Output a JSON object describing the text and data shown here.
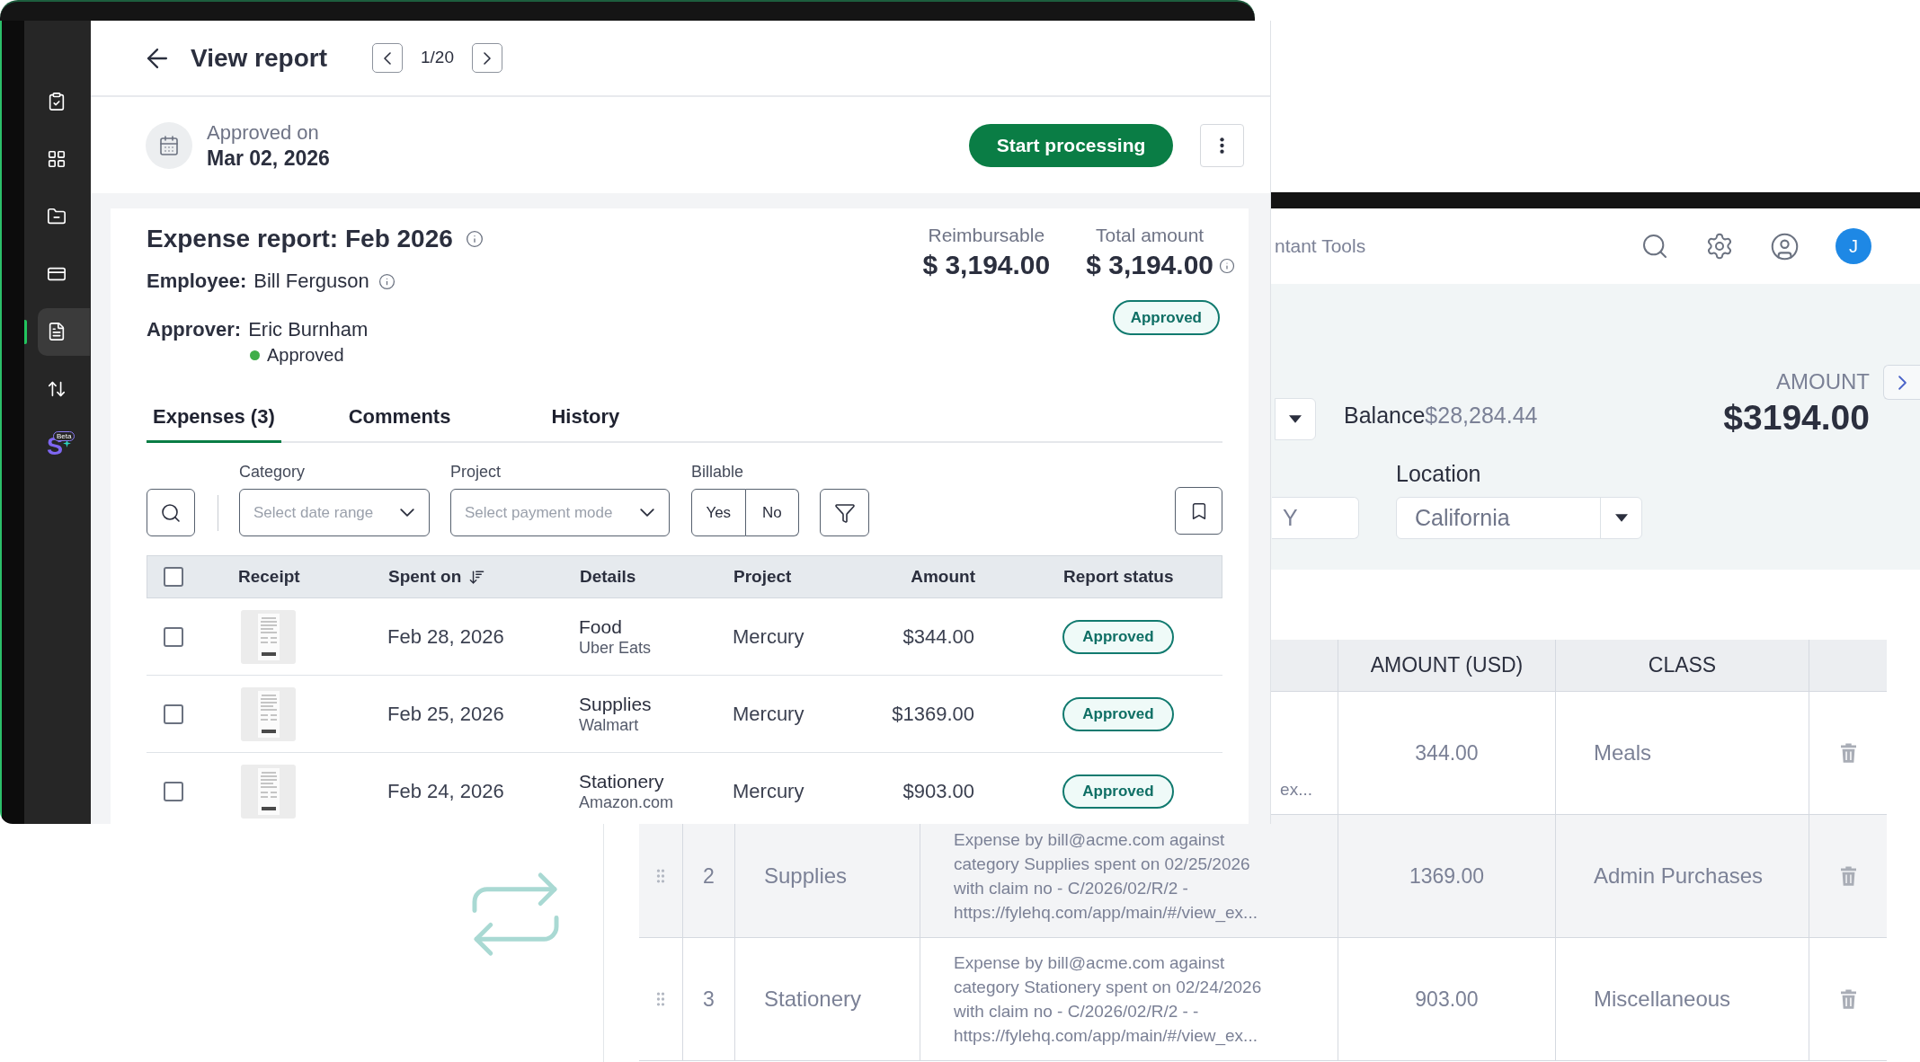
{
  "front": {
    "sidebar": [
      {
        "kind": "icon",
        "selected": false
      },
      {
        "kind": "icon",
        "selected": false
      },
      {
        "kind": "icon",
        "selected": false
      },
      {
        "kind": "icon",
        "selected": false
      },
      {
        "kind": "icon",
        "selected": true
      },
      {
        "kind": "icon",
        "selected": false
      },
      {
        "kind": "logo",
        "logo": "S",
        "badge": "Beta",
        "selected": false
      }
    ],
    "header": {
      "title": "View report",
      "pager": "1/20"
    },
    "approval": {
      "label": "Approved on",
      "date": "Mar 02, 2026",
      "action": "Start processing"
    },
    "report": {
      "title": "Expense report: Feb 2026",
      "employee": {
        "label": "Employee:",
        "value": "Bill Ferguson"
      },
      "approver": {
        "label": "Approver:",
        "value": "Eric Burnham",
        "status": "Approved"
      },
      "totals": [
        {
          "label": "Reimbursable",
          "value": "$ 3,194.00"
        },
        {
          "label": "Total amount",
          "value": "$ 3,194.00",
          "info": true
        }
      ],
      "status": "Approved"
    },
    "tabs": [
      {
        "label": "Expenses (3)",
        "selected": true
      },
      {
        "label": "Comments",
        "selected": false
      },
      {
        "label": "History",
        "selected": false
      }
    ],
    "filters": [
      {
        "kind": "select",
        "label": "Category",
        "placeholder": "Select date range"
      },
      {
        "kind": "select",
        "label": "Project",
        "placeholder": "Select payment mode"
      },
      {
        "kind": "toggle",
        "label": "Billable",
        "options": [
          {
            "label": "Yes",
            "selected": false
          },
          {
            "label": "No",
            "selected": false
          }
        ]
      }
    ],
    "table": {
      "checked": false,
      "columns": [
        {
          "label": "Receipt",
          "sorted": false
        },
        {
          "label": "Spent on",
          "sorted": true
        },
        {
          "label": "Details",
          "sorted": false
        },
        {
          "label": "Project",
          "sorted": false
        },
        {
          "label": "Amount",
          "sorted": false
        },
        {
          "label": "Report status",
          "sorted": false
        }
      ],
      "rows": [
        {
          "checked": false,
          "spent_on": "Feb 28, 2026",
          "category": "Food",
          "merchant": "Uber Eats",
          "project": "Mercury",
          "amount": "$344.00",
          "status": "Approved"
        },
        {
          "checked": false,
          "spent_on": "Feb 25, 2026",
          "category": "Supplies",
          "merchant": "Walmart",
          "project": "Mercury",
          "amount": "$1369.00",
          "status": "Approved"
        },
        {
          "checked": false,
          "spent_on": "Feb 24, 2026",
          "category": "Stationery",
          "merchant": "Amazon.com",
          "project": "Mercury",
          "amount": "$903.00",
          "status": "Approved"
        }
      ]
    }
  },
  "back": {
    "header": {
      "title": "ntant Tools",
      "avatar": "J"
    },
    "balance": {
      "label": "Balance",
      "value": "$28,284.44"
    },
    "amount": {
      "label": "AMOUNT",
      "value": "$3194.00"
    },
    "fields": {
      "partial_value": "Y",
      "location": {
        "label": "Location",
        "value": "California"
      }
    },
    "table": {
      "columns": [
        "AMOUNT (USD)",
        "CLASS"
      ],
      "rows": [
        {
          "highlighted": false,
          "description_tail": "ex...",
          "amount": "344.00",
          "class": "Meals"
        },
        {
          "highlighted": true,
          "number": "2",
          "category": "Supplies",
          "description_lines": [
            "Expense by bill@acme.com against",
            "category Supplies spent on 02/25/2026",
            "with claim no - C/2026/02/R/2 -",
            "https://fylehq.com/app/main/#/view_ex..."
          ],
          "amount": "1369.00",
          "class": "Admin Purchases"
        },
        {
          "highlighted": false,
          "number": "3",
          "category": "Stationery",
          "description_lines": [
            "Expense by bill@acme.com against",
            "category Stationery spent on 02/24/2026",
            "with claim no - C/2026/02/R/2 - -",
            "https://fylehq.com/app/main/#/view_ex..."
          ],
          "amount": "903.00",
          "class": "Miscellaneous"
        }
      ]
    }
  }
}
